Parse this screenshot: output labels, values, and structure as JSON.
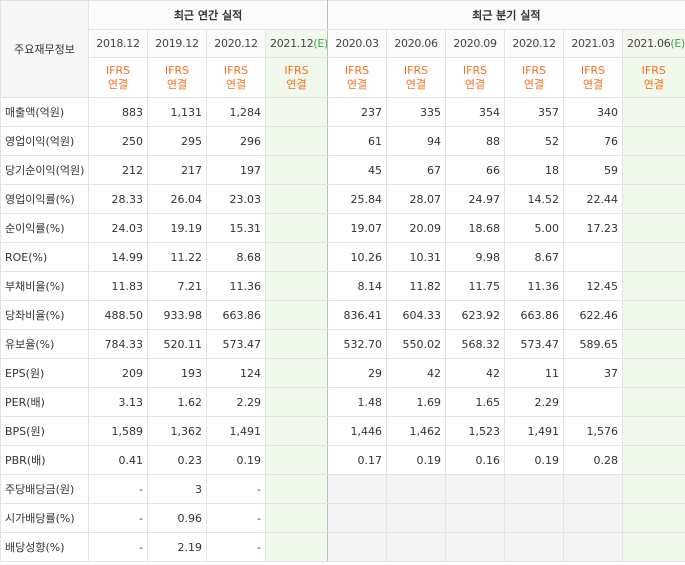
{
  "table": {
    "corner_label": "주요재무정보",
    "annual_group": "최근 연간 실적",
    "quarter_group": "최근 분기 실적",
    "annual_dates": [
      "2018.12",
      "2019.12",
      "2020.12",
      "2021.12"
    ],
    "annual_est_suffix": "(E)",
    "quarter_dates": [
      "2020.03",
      "2020.06",
      "2020.09",
      "2020.12",
      "2021.03",
      "2021.06"
    ],
    "quarter_est_suffix": "(E)",
    "ifrs_top": "IFRS",
    "ifrs_bottom": "연결",
    "rows": [
      {
        "label": "매출액(억원)",
        "annual": [
          "883",
          "1,131",
          "1,284",
          ""
        ],
        "quarter": [
          "237",
          "335",
          "354",
          "357",
          "340",
          ""
        ]
      },
      {
        "label": "영업이익(억원)",
        "annual": [
          "250",
          "295",
          "296",
          ""
        ],
        "quarter": [
          "61",
          "94",
          "88",
          "52",
          "76",
          ""
        ]
      },
      {
        "label": "당기순이익(억원)",
        "annual": [
          "212",
          "217",
          "197",
          ""
        ],
        "quarter": [
          "45",
          "67",
          "66",
          "18",
          "59",
          ""
        ]
      },
      {
        "label": "영업이익률(%)",
        "annual": [
          "28.33",
          "26.04",
          "23.03",
          ""
        ],
        "quarter": [
          "25.84",
          "28.07",
          "24.97",
          "14.52",
          "22.44",
          ""
        ]
      },
      {
        "label": "순이익률(%)",
        "annual": [
          "24.03",
          "19.19",
          "15.31",
          ""
        ],
        "quarter": [
          "19.07",
          "20.09",
          "18.68",
          "5.00",
          "17.23",
          ""
        ]
      },
      {
        "label": "ROE(%)",
        "annual": [
          "14.99",
          "11.22",
          "8.68",
          ""
        ],
        "quarter": [
          "10.26",
          "10.31",
          "9.98",
          "8.67",
          "",
          ""
        ]
      },
      {
        "label": "부채비율(%)",
        "annual": [
          "11.83",
          "7.21",
          "11.36",
          ""
        ],
        "quarter": [
          "8.14",
          "11.82",
          "11.75",
          "11.36",
          "12.45",
          ""
        ]
      },
      {
        "label": "당좌비율(%)",
        "annual": [
          "488.50",
          "933.98",
          "663.86",
          ""
        ],
        "quarter": [
          "836.41",
          "604.33",
          "623.92",
          "663.86",
          "622.46",
          ""
        ]
      },
      {
        "label": "유보율(%)",
        "annual": [
          "784.33",
          "520.11",
          "573.47",
          ""
        ],
        "quarter": [
          "532.70",
          "550.02",
          "568.32",
          "573.47",
          "589.65",
          ""
        ]
      },
      {
        "label": "EPS(원)",
        "annual": [
          "209",
          "193",
          "124",
          ""
        ],
        "quarter": [
          "29",
          "42",
          "42",
          "11",
          "37",
          ""
        ]
      },
      {
        "label": "PER(배)",
        "annual": [
          "3.13",
          "1.62",
          "2.29",
          ""
        ],
        "quarter": [
          "1.48",
          "1.69",
          "1.65",
          "2.29",
          "",
          ""
        ]
      },
      {
        "label": "BPS(원)",
        "annual": [
          "1,589",
          "1,362",
          "1,491",
          ""
        ],
        "quarter": [
          "1,446",
          "1,462",
          "1,523",
          "1,491",
          "1,576",
          ""
        ]
      },
      {
        "label": "PBR(배)",
        "annual": [
          "0.41",
          "0.23",
          "0.19",
          ""
        ],
        "quarter": [
          "0.17",
          "0.19",
          "0.16",
          "0.19",
          "0.28",
          ""
        ]
      },
      {
        "label": "주당배당금(원)",
        "annual": [
          "-",
          "3",
          "-",
          ""
        ],
        "quarter": [
          "",
          "",
          "",
          "",
          "",
          ""
        ],
        "quarter_blank": true
      },
      {
        "label": "시가배당률(%)",
        "annual": [
          "-",
          "0.96",
          "-",
          ""
        ],
        "quarter": [
          "",
          "",
          "",
          "",
          "",
          ""
        ],
        "quarter_blank": true
      },
      {
        "label": "배당성향(%)",
        "annual": [
          "-",
          "2.19",
          "-",
          ""
        ],
        "quarter": [
          "",
          "",
          "",
          "",
          "",
          ""
        ],
        "quarter_blank": true
      }
    ],
    "section_starts": [
      3,
      6,
      9,
      13
    ],
    "colors": {
      "ifrs": "#f37021",
      "estimate_bg": "#f1f8ec",
      "estimate_text": "#3fa34d"
    }
  }
}
